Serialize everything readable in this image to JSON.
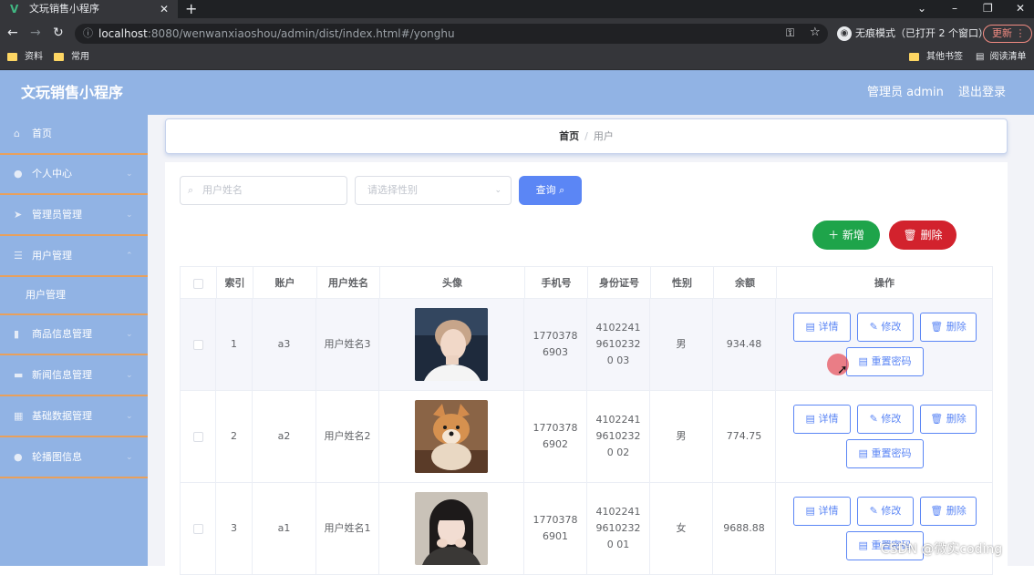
{
  "browser": {
    "tab_title": "文玩销售小程序",
    "url_host": "localhost",
    "url_path": ":8080/wenwanxiaoshou/admin/dist/index.html#/yonghu",
    "incognito_label": "无痕模式（已打开 2 个窗口）",
    "update_label": "更新",
    "bookmarks": [
      "资料",
      "常用"
    ],
    "bookmarks_right": [
      "其他书签",
      "阅读清单"
    ]
  },
  "header": {
    "title": "文玩销售小程序",
    "admin_label": "管理员 admin",
    "logout_label": "退出登录"
  },
  "sidebar": {
    "items": [
      {
        "label": "首页",
        "icon": "home-icon"
      },
      {
        "label": "个人中心",
        "icon": "user-icon"
      },
      {
        "label": "管理员管理",
        "icon": "send-icon"
      },
      {
        "label": "用户管理",
        "icon": "menu-icon"
      },
      {
        "label": "用户管理",
        "icon": ""
      },
      {
        "label": "商品信息管理",
        "icon": "chart-icon"
      },
      {
        "label": "新闻信息管理",
        "icon": "news-icon"
      },
      {
        "label": "基础数据管理",
        "icon": "grid-icon"
      },
      {
        "label": "轮播图信息",
        "icon": "user-icon"
      }
    ]
  },
  "breadcrumb": {
    "home": "首页",
    "separator": "/",
    "current": "用户"
  },
  "search": {
    "name_placeholder": "用户姓名",
    "sex_placeholder": "请选择性别",
    "query_label": "查询"
  },
  "actions": {
    "add_label": "新增",
    "delete_label": "删除"
  },
  "table": {
    "columns": [
      "索引",
      "账户",
      "用户姓名",
      "头像",
      "手机号",
      "身份证号",
      "性别",
      "余额",
      "操作"
    ],
    "rows": [
      {
        "index": "1",
        "account": "a3",
        "name": "用户姓名3",
        "phone": "17703786903",
        "idcard": "410224196102320 03",
        "sex": "男",
        "balance": "934.48",
        "avatar": "boy"
      },
      {
        "index": "2",
        "account": "a2",
        "name": "用户姓名2",
        "phone": "17703786902",
        "idcard": "410224196102320 02",
        "sex": "男",
        "balance": "774.75",
        "avatar": "dog"
      },
      {
        "index": "3",
        "account": "a1",
        "name": "用户姓名1",
        "phone": "17703786901",
        "idcard": "410224196102320 01",
        "sex": "女",
        "balance": "9688.88",
        "avatar": "girl"
      }
    ],
    "op_labels": {
      "detail": "详情",
      "edit": "修改",
      "delete": "删除",
      "reset": "重置密码"
    }
  },
  "watermark": "CSDN @微实coding",
  "colors": {
    "header": "#91b3e4",
    "primary": "#5b86f5",
    "success": "#1ea44a",
    "danger": "#d2222d"
  }
}
